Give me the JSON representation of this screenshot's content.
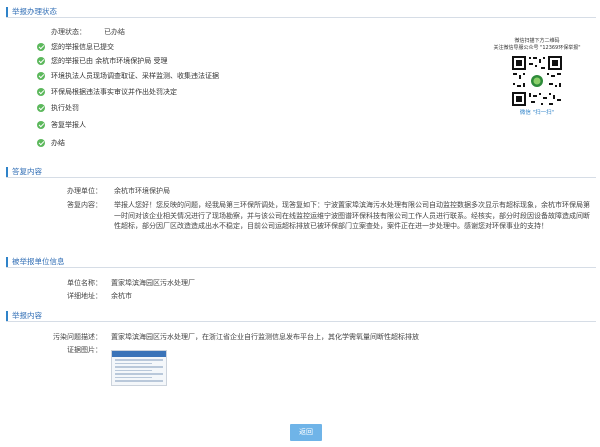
{
  "sections": {
    "status": "举报办理状态",
    "reply": "答复内容",
    "reported": "被举报单位信息",
    "content": "举报内容"
  },
  "status": {
    "label": "办理状态：",
    "value": "已办结",
    "steps": [
      "您的举报信息已提交",
      "您的举报已由 余杭市环境保护局 受理",
      "环境执法人员现场调查取证、采样监测、收集违法证据",
      "环保局根据违法事实审议并作出处罚决定",
      "执行处罚",
      "答复举报人",
      "办结"
    ]
  },
  "qr": {
    "caption_line1": "微信扫描下方二维码",
    "caption_line2": "关注微信导服公众号 \"12369环保举报\"",
    "footer": "微信 \"扫一扫\""
  },
  "reply": {
    "unit_label": "办理单位：",
    "unit_value": "余杭市环境保护局",
    "content_label": "答复内容：",
    "content_value": "举报人您好！您反映的问题，经我局第三环保所调处，现答复如下：宁波置家埠滨海污水处理有限公司自动监控数据多次显示有超标现象，余杭市环保局第一时间对该企业相关情况进行了现场勘察，并与该公司在线监控运维宁波图谱环保科技有限公司工作人员进行联系。经核实，部分时段因设备故障造成间断性超标，部分因厂区改造造成出水不稳定，目前公司运超标排放已被环保部门立案查处，案件正在进一步处理中。感谢您对环保事业的支持！"
  },
  "reported": {
    "name_label": "单位名称：",
    "name_value": "置家埠滨海园区污水处理厂",
    "address_label": "详细地址：",
    "address_value": "余杭市"
  },
  "content": {
    "issue_label": "污染问题描述：",
    "issue_value": "置家埠滨海园区污水处理厂，在浙江省企业自行监测信息发布平台上，其化学需氧量间断性超标排放",
    "evidence_label": "证据图片："
  },
  "button": {
    "back": "返回"
  },
  "colors": {
    "accent": "#2f83c9",
    "check": "#5cb85c",
    "button": "#6fb4e8"
  }
}
